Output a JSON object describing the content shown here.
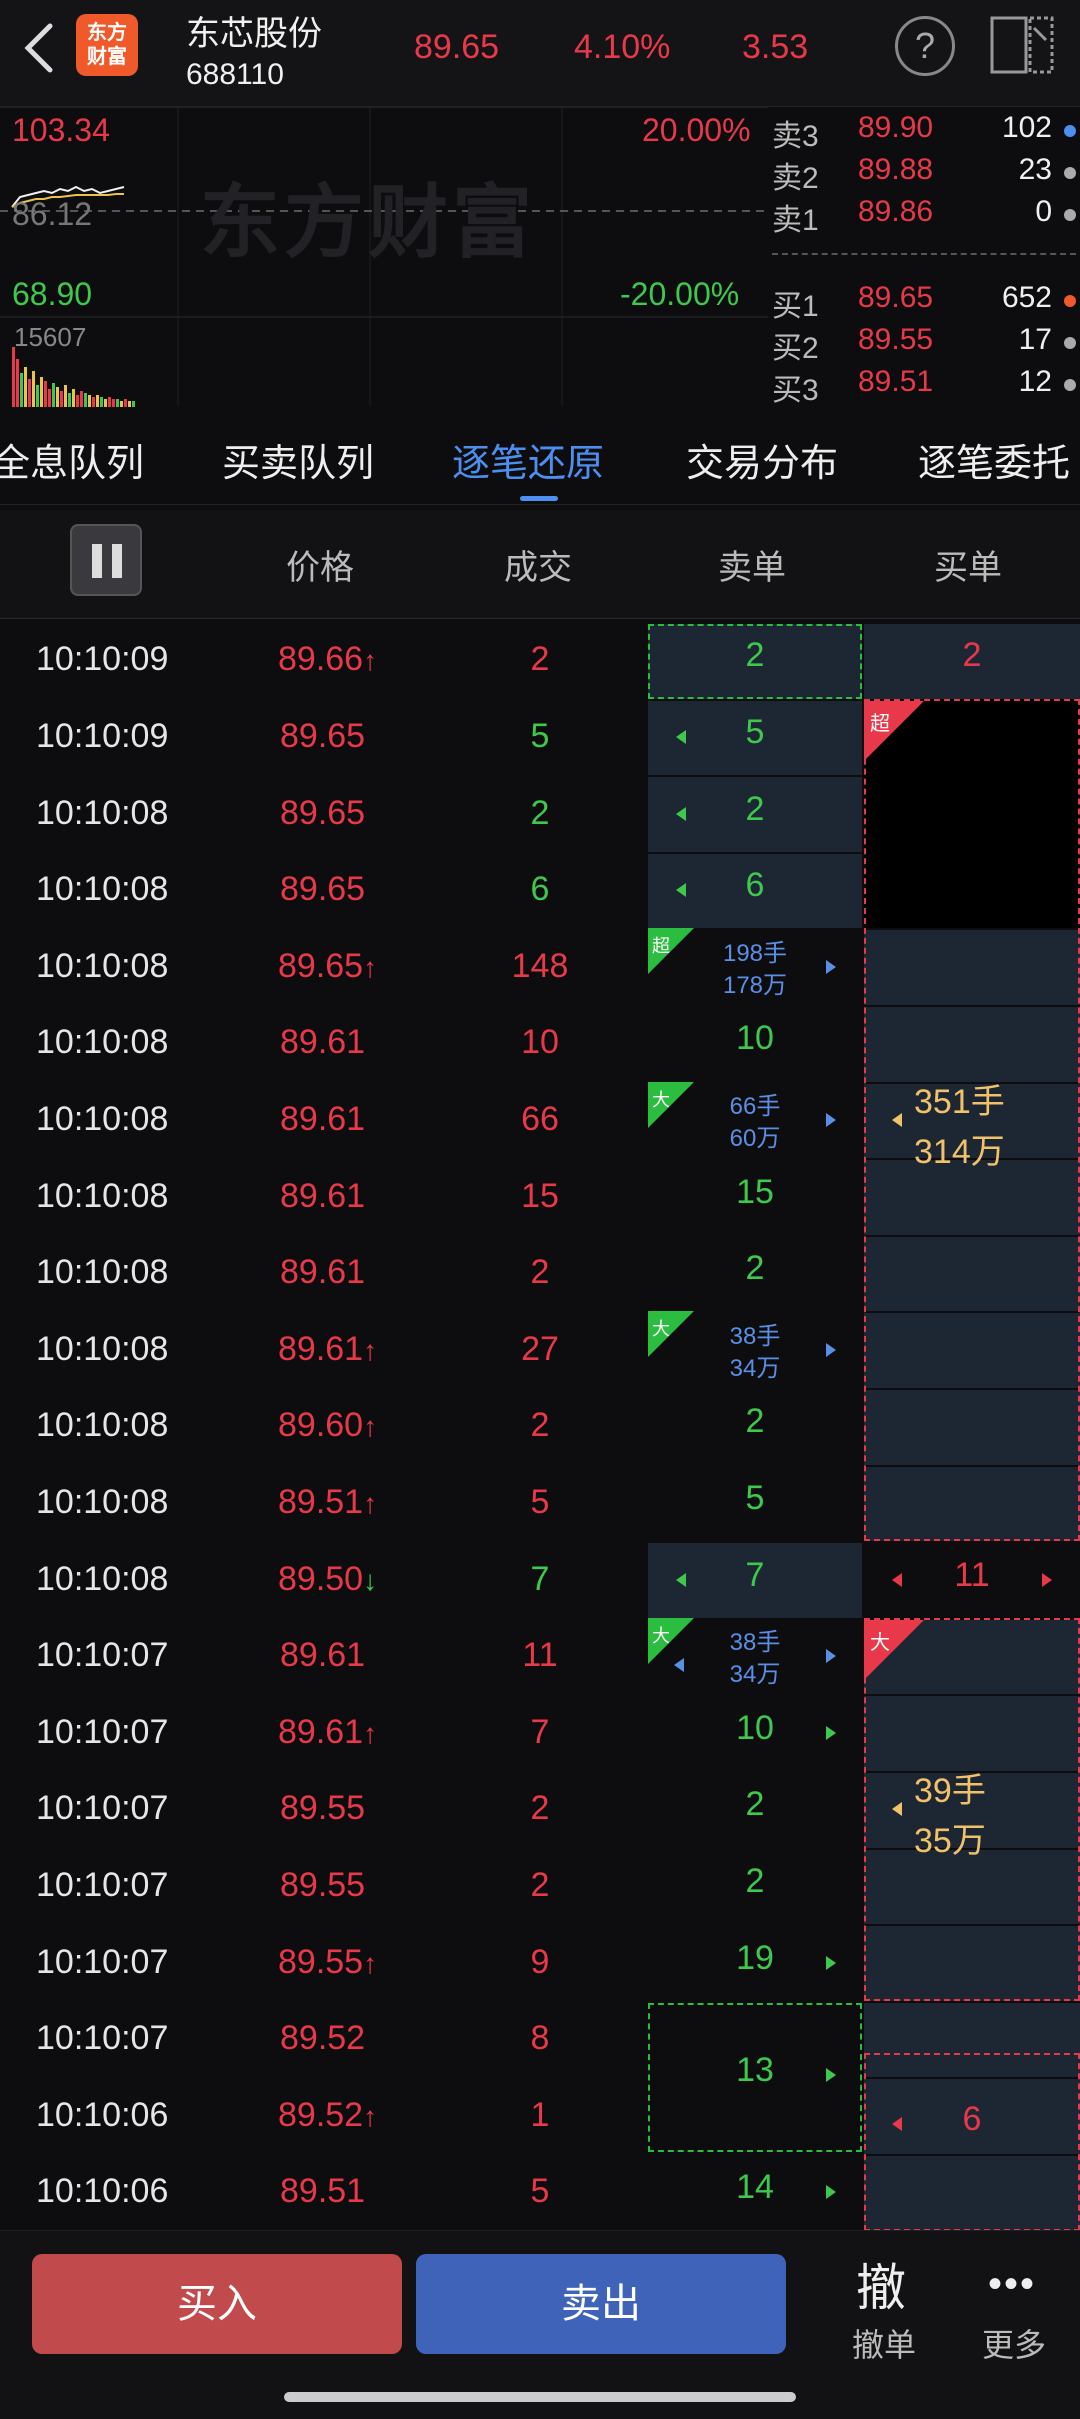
{
  "header": {
    "logo_line1": "东方",
    "logo_line2": "财富",
    "stock_name": "东芯股份",
    "stock_code": "688110",
    "price": "89.65",
    "change_pct": "4.10%",
    "change": "3.53",
    "help": "?"
  },
  "chart": {
    "watermark": "东方财富",
    "high_price": "103.34",
    "high_pct": "20.00%",
    "mid_price": "86.12",
    "low_price": "68.90",
    "low_pct": "-20.00%",
    "volume": "15607"
  },
  "order_book": [
    {
      "label": "卖3",
      "price": "89.90",
      "volume": "102",
      "dot": "#4d8ff0"
    },
    {
      "label": "卖2",
      "price": "89.88",
      "volume": "23",
      "dot": "#aaaaaa"
    },
    {
      "label": "卖1",
      "price": "89.86",
      "volume": "0",
      "dot": "#aaaaaa"
    },
    {
      "label": "买1",
      "price": "89.65",
      "volume": "652",
      "dot": "#f05a2a"
    },
    {
      "label": "买2",
      "price": "89.55",
      "volume": "17",
      "dot": "#aaaaaa"
    },
    {
      "label": "买3",
      "price": "89.51",
      "volume": "12",
      "dot": "#aaaaaa"
    }
  ],
  "tabs": [
    "全息队列",
    "买卖队列",
    "逐笔还原",
    "交易分布",
    "逐笔委托"
  ],
  "active_tab": 2,
  "table_headers": {
    "price": "价格",
    "volume": "成交",
    "sell": "卖单",
    "buy": "买单"
  },
  "rows": [
    {
      "time": "10:10:09",
      "price": "89.66",
      "arrow": "↑",
      "vol": "2",
      "vol_color": "red",
      "sell": "2",
      "buy": "2"
    },
    {
      "time": "10:10:09",
      "price": "89.65",
      "arrow": "",
      "vol": "5",
      "vol_color": "green",
      "sell": "5",
      "buy": ""
    },
    {
      "time": "10:10:08",
      "price": "89.65",
      "arrow": "",
      "vol": "2",
      "vol_color": "green",
      "sell": "2",
      "buy": ""
    },
    {
      "time": "10:10:08",
      "price": "89.65",
      "arrow": "",
      "vol": "6",
      "vol_color": "green",
      "sell": "6",
      "buy": ""
    },
    {
      "time": "10:10:08",
      "price": "89.65",
      "arrow": "↑",
      "vol": "148",
      "vol_color": "red",
      "sell_top": "198手",
      "sell_bottom": "178万",
      "buy": ""
    },
    {
      "time": "10:10:08",
      "price": "89.61",
      "arrow": "",
      "vol": "10",
      "vol_color": "red",
      "sell": "10",
      "buy": ""
    },
    {
      "time": "10:10:08",
      "price": "89.61",
      "arrow": "",
      "vol": "66",
      "vol_color": "red",
      "sell_top": "66手",
      "sell_bottom": "60万",
      "buy": ""
    },
    {
      "time": "10:10:08",
      "price": "89.61",
      "arrow": "",
      "vol": "15",
      "vol_color": "red",
      "sell": "15",
      "buy": ""
    },
    {
      "time": "10:10:08",
      "price": "89.61",
      "arrow": "",
      "vol": "2",
      "vol_color": "red",
      "sell": "2",
      "buy": ""
    },
    {
      "time": "10:10:08",
      "price": "89.61",
      "arrow": "↑",
      "vol": "27",
      "vol_color": "red",
      "sell_top": "38手",
      "sell_bottom": "34万",
      "buy": ""
    },
    {
      "time": "10:10:08",
      "price": "89.60",
      "arrow": "↑",
      "vol": "2",
      "vol_color": "red",
      "sell": "2",
      "buy": ""
    },
    {
      "time": "10:10:08",
      "price": "89.51",
      "arrow": "↑",
      "vol": "5",
      "vol_color": "red",
      "sell": "5",
      "buy": ""
    },
    {
      "time": "10:10:08",
      "price": "89.50",
      "arrow": "↓",
      "vol": "7",
      "vol_color": "green",
      "sell": "7",
      "buy": "11"
    },
    {
      "time": "10:10:07",
      "price": "89.61",
      "arrow": "",
      "vol": "11",
      "vol_color": "red",
      "sell_top": "38手",
      "sell_bottom": "34万",
      "buy": ""
    },
    {
      "time": "10:10:07",
      "price": "89.61",
      "arrow": "↑",
      "vol": "7",
      "vol_color": "red",
      "sell": "10",
      "buy": ""
    },
    {
      "time": "10:10:07",
      "price": "89.55",
      "arrow": "",
      "vol": "2",
      "vol_color": "red",
      "sell": "2",
      "buy": ""
    },
    {
      "time": "10:10:07",
      "price": "89.55",
      "arrow": "",
      "vol": "2",
      "vol_color": "red",
      "sell": "2",
      "buy": ""
    },
    {
      "time": "10:10:07",
      "price": "89.55",
      "arrow": "↑",
      "vol": "9",
      "vol_color": "red",
      "sell": "19",
      "buy": ""
    },
    {
      "time": "10:10:07",
      "price": "89.52",
      "arrow": "",
      "vol": "8",
      "vol_color": "red",
      "sell": "13",
      "buy": ""
    },
    {
      "time": "10:10:06",
      "price": "89.52",
      "arrow": "↑",
      "vol": "1",
      "vol_color": "red",
      "sell": "",
      "buy": "6"
    },
    {
      "time": "10:10:06",
      "price": "89.51",
      "arrow": "",
      "vol": "5",
      "vol_color": "red",
      "sell": "14",
      "buy": ""
    }
  ],
  "badges": {
    "super": "超",
    "big": "大"
  },
  "buy_groups": [
    {
      "top": "351手",
      "bottom": "314万"
    },
    {
      "top": "39手",
      "bottom": "35万"
    }
  ],
  "bottom_bar": {
    "buy": "买入",
    "sell": "卖出",
    "cancel_icon": "撤",
    "cancel_label": "撤单",
    "more_icon": "•••",
    "more_label": "更多"
  }
}
